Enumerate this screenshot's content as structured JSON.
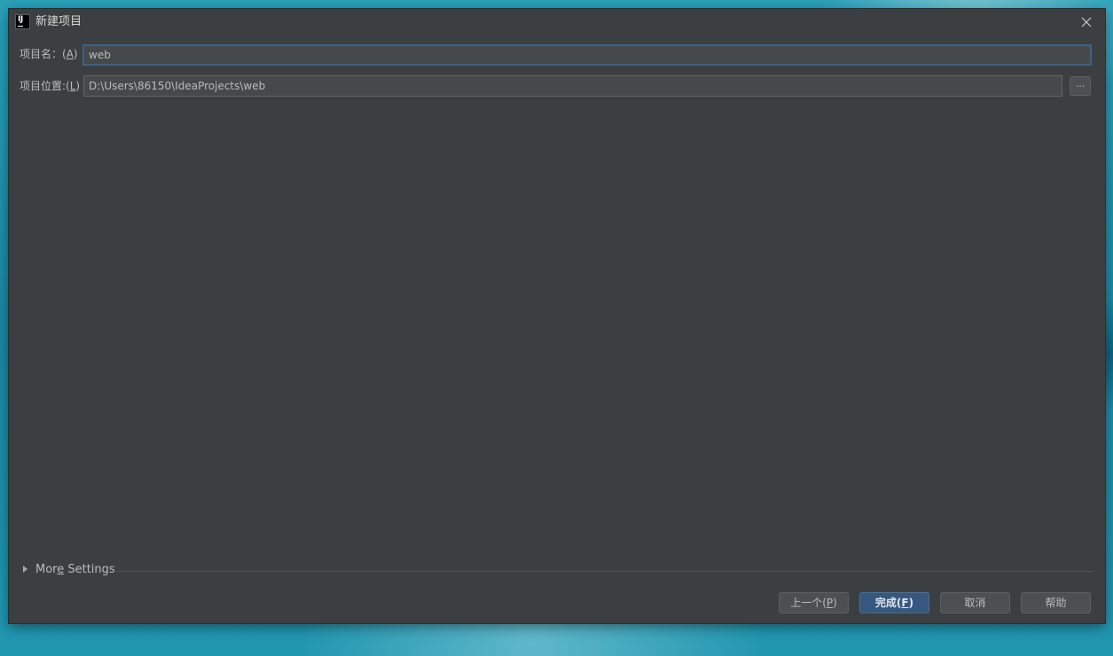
{
  "window": {
    "title": "新建项目",
    "app_icon_text": "IJ"
  },
  "form": {
    "name_label_prefix": "项目名：(",
    "name_label_mnemonic": "A",
    "name_label_suffix": ")",
    "name_value": "web",
    "location_label_prefix": "项目位置:(",
    "location_label_mnemonic": "L",
    "location_label_suffix": ")",
    "location_value": "D:\\Users\\86150\\IdeaProjects\\web",
    "browse_label": "..."
  },
  "more_settings": {
    "label_prefix": "Mor",
    "label_mnemonic": "e",
    "label_suffix": " Settings"
  },
  "buttons": {
    "previous_prefix": "上一个(",
    "previous_mnemonic": "P",
    "previous_suffix": ")",
    "finish_prefix": "完成(",
    "finish_mnemonic": "F",
    "finish_suffix": ")",
    "cancel": "取消",
    "help": "帮助"
  },
  "colors": {
    "dialog_bg": "#3c3f41",
    "input_bg": "#45494a",
    "focus_border": "#3d6185",
    "primary_button": "#365880",
    "text": "#bbbbbb"
  },
  "icons": {
    "app": "intellij-idea-icon",
    "close": "close-icon",
    "expand": "triangle-right-icon"
  }
}
